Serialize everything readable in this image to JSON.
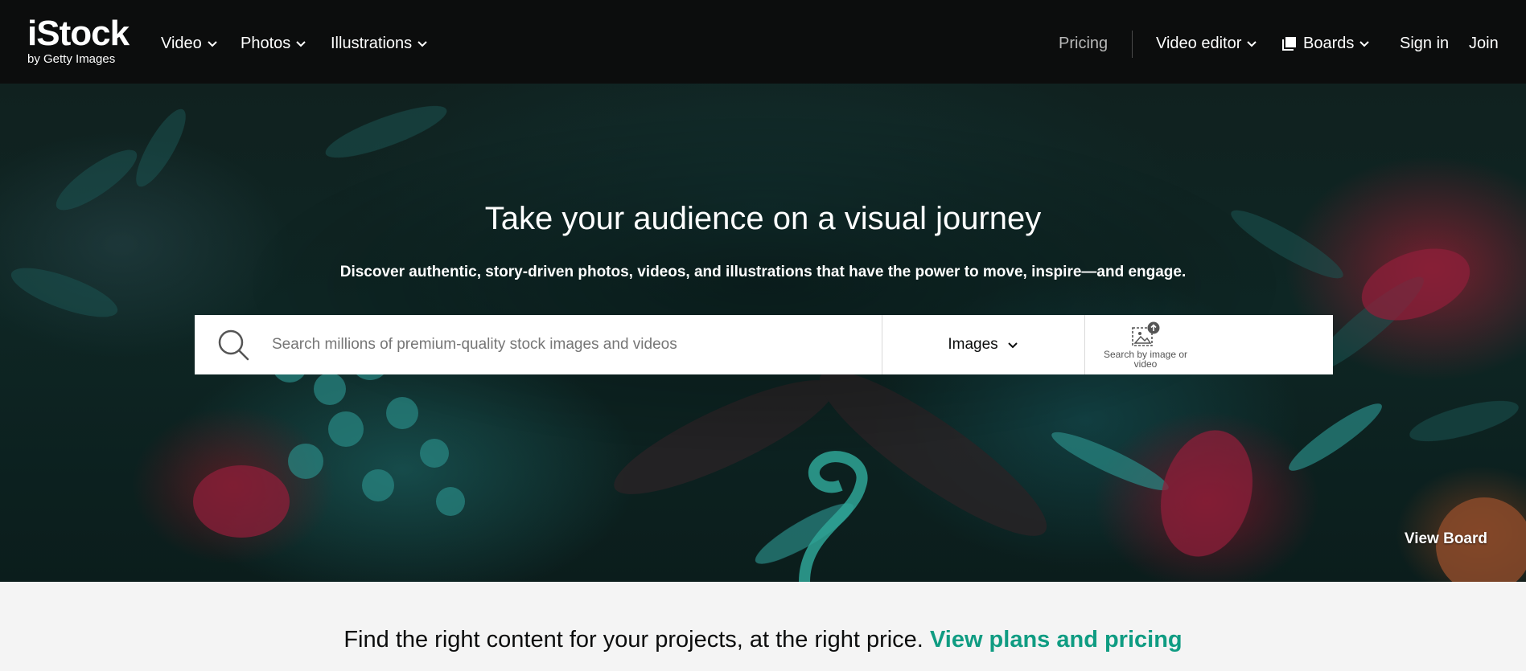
{
  "header": {
    "logo_main": "iStock",
    "logo_sub": "by Getty Images",
    "nav_left": [
      {
        "label": "Video"
      },
      {
        "label": "Photos"
      },
      {
        "label": "Illustrations"
      }
    ],
    "pricing_label": "Pricing",
    "video_editor_label": "Video editor",
    "boards_label": "Boards",
    "sign_in_label": "Sign in",
    "join_label": "Join",
    "icons": {
      "chevron": "chevron-down-icon",
      "boards": "boards-icon"
    }
  },
  "hero": {
    "title": "Take your audience on a visual journey",
    "subtitle": "Discover authentic, story-driven photos, videos, and illustrations that have the power to move, inspire—and engage.",
    "search": {
      "placeholder": "Search millions of premium-quality stock images and videos",
      "value": "",
      "type_selected": "Images",
      "visual_search_label": "Search by image or video"
    },
    "view_board_label": "View Board"
  },
  "pricing_strip": {
    "text": "Find the right content for your projects, at the right price.",
    "link_label": "View plans and pricing"
  },
  "colors": {
    "nav_bg": "#0c0d0d",
    "accent_green": "#0f9c82",
    "strip_bg": "#f4f4f4"
  }
}
